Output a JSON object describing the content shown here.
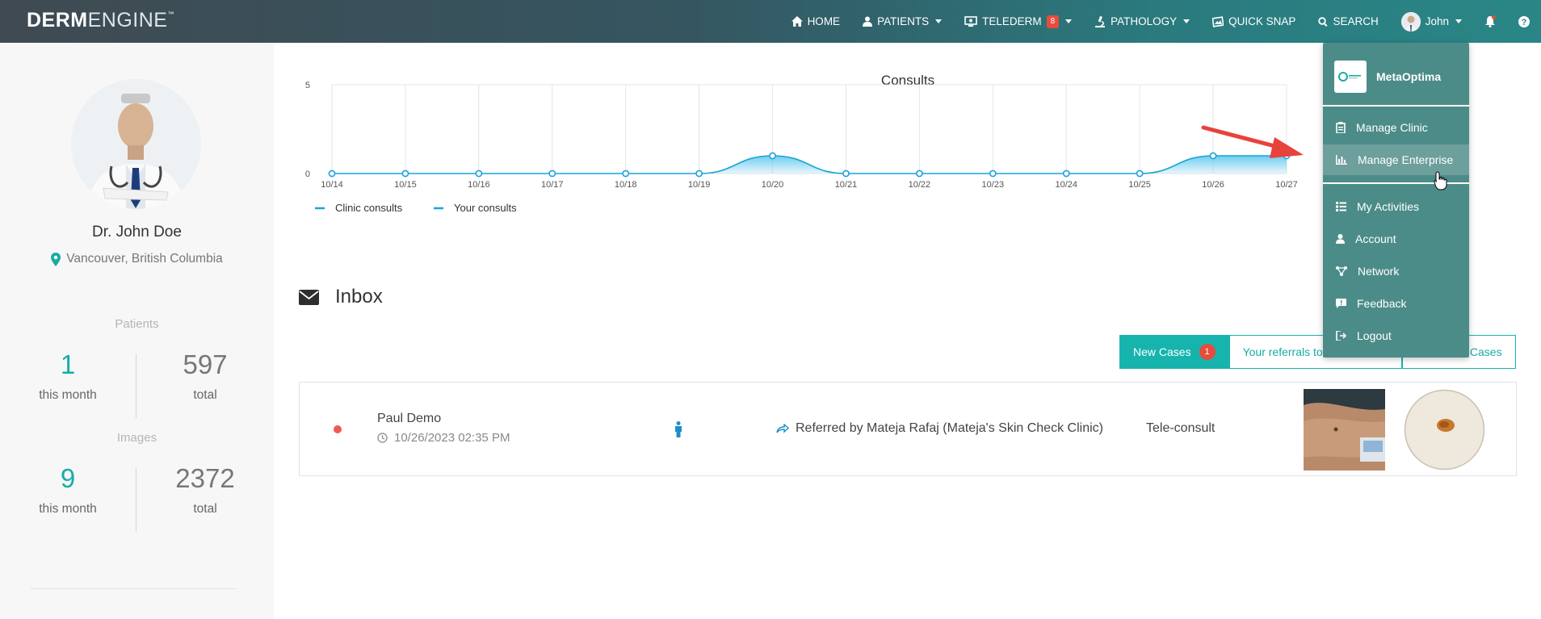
{
  "navbar": {
    "brand_bold": "DERM",
    "brand_light": "ENGINE",
    "brand_tm": "™",
    "items": [
      {
        "label": "HOME",
        "icon": "home-icon"
      },
      {
        "label": "PATIENTS",
        "icon": "patients-icon"
      },
      {
        "label": "TELEDERM",
        "icon": "telederm-icon",
        "badge": "8"
      },
      {
        "label": "PATHOLOGY",
        "icon": "microscope-icon"
      },
      {
        "label": "QUICK SNAP",
        "icon": "snap-icon"
      },
      {
        "label": "SEARCH",
        "icon": "search-icon"
      }
    ],
    "user": "John"
  },
  "sidebar": {
    "doctor_name": "Dr. John Doe",
    "location": "Vancouver, British Columbia",
    "patients_title": "Patients",
    "patients_month": "1",
    "patients_month_label": "this month",
    "patients_total": "597",
    "patients_total_label": "total",
    "images_title": "Images",
    "images_month": "9",
    "images_month_label": "this month",
    "images_total": "2372",
    "images_total_label": "total"
  },
  "chart_data": {
    "type": "area",
    "title": "Consults",
    "categories": [
      "10/14",
      "10/15",
      "10/16",
      "10/17",
      "10/18",
      "10/19",
      "10/20",
      "10/21",
      "10/22",
      "10/23",
      "10/24",
      "10/25",
      "10/26",
      "10/27"
    ],
    "series": [
      {
        "name": "Clinic consults",
        "values": [
          0,
          0,
          0,
          0,
          0,
          0,
          1,
          0,
          0,
          0,
          0,
          0,
          1,
          1
        ]
      },
      {
        "name": "Your consults",
        "values": [
          0,
          0,
          0,
          0,
          0,
          0,
          1,
          0,
          0,
          0,
          0,
          0,
          1,
          1
        ]
      }
    ],
    "ylim": [
      0,
      5
    ],
    "yticks": [
      "0",
      "5"
    ],
    "colors": {
      "line": "#1aa3d9",
      "fill": "#5ec8ec"
    },
    "legend": "bottom-left",
    "grid": true
  },
  "inbox": {
    "title": "Inbox",
    "tabs": [
      {
        "label": "New Cases",
        "badge": "1"
      },
      {
        "label": "Your referrals to"
      },
      {
        "label": "Cases"
      }
    ],
    "case": {
      "patient": "Paul Demo",
      "datetime": "10/26/2023 02:35 PM",
      "referral": "Referred by Mateja Rafaj (Mateja's Skin Check Clinic)",
      "type": "Tele-consult"
    }
  },
  "dropdown": {
    "org": "MetaOptima",
    "items": [
      {
        "label": "Manage Clinic",
        "icon": "clipboard-icon"
      },
      {
        "label": "Manage Enterprise",
        "icon": "bar-chart-icon"
      },
      {
        "label": "My Activities",
        "icon": "list-icon"
      },
      {
        "label": "Account",
        "icon": "user-icon"
      },
      {
        "label": "Network",
        "icon": "network-icon"
      },
      {
        "label": "Feedback",
        "icon": "comment-icon"
      },
      {
        "label": "Logout",
        "icon": "logout-icon"
      }
    ]
  },
  "colors": {
    "accent": "#17b4ae",
    "badge": "#e74c3c",
    "dropdown": "#4c8c88"
  }
}
